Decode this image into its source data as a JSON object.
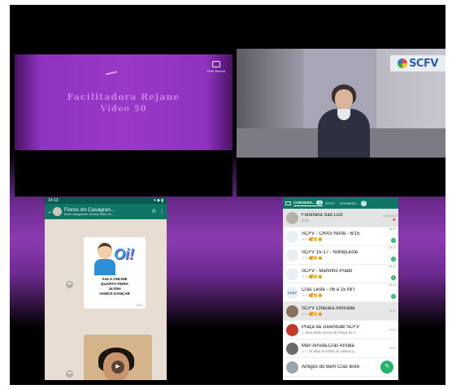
{
  "slide": {
    "title": "Facilitadora Rejane",
    "subtitle": "Vídeo 50",
    "record_label": "Pare Record"
  },
  "camera": {
    "logo_text": "SCFV"
  },
  "phone_chat": {
    "status_time": "14:13",
    "group_name": "Flores do Casagran...",
    "group_members": "Elvira Casagrande, Eneida, Erika, Eri...",
    "message_caption": [
      "AULA ONLINE",
      "QUARTA FEIRA",
      "16:00H",
      "VAMOS DANÇAR"
    ],
    "message_time": "14:07"
  },
  "whatsapp": {
    "tabs": [
      {
        "label": "CONVERS...",
        "count": "10",
        "active": true
      },
      {
        "label": "STAT...",
        "active": false
      },
      {
        "label": "CHAMAD...",
        "active": false
      }
    ],
    "chats": [
      {
        "name": "Funerária São Luiz",
        "preview": "0:14",
        "time": "07/05/2020",
        "pinned": true,
        "avatar": "#b6b0a8"
      },
      {
        "name": "SCFV - CRAS Norte - 6/15",
        "preview": "✓✓ 🥰🙂😄",
        "time": "14:11",
        "badge": "1",
        "avatar": "#e9eef3"
      },
      {
        "name": "SCFV 15-17 - Norte|Leste",
        "preview": "✓✓ 🥰🙂😄",
        "time": "14:11",
        "badge": "1",
        "avatar": "#e9eef3"
      },
      {
        "name": "SCFV - Martinho Prado",
        "preview": "✓✓ 🥰🙂😄",
        "time": "14:11",
        "badge": "1",
        "avatar": "#e9eef3"
      },
      {
        "name": "Cras Leste - 06 a 15 M/T",
        "preview": "✓✓ 🥰🙂😄",
        "time": "14:11",
        "badge": "1",
        "avatar": "#e9eef3",
        "avatar_text": "SCFV"
      },
      {
        "name": "SCFV  Chácara  Alvorada",
        "preview": "✓✓ 🥰🙂😄",
        "time": "14:11",
        "avatar": "#8a6f5c",
        "highlight": true
      },
      {
        "name": "Praça da Juventude SCFV",
        "preview": "✓ Boa tarde turma da Praça de J...",
        "time": "14:10",
        "avatar": "#c0392b"
      },
      {
        "name": "Mari Arruda.Cras Arruda",
        "preview": "✓✓ Oi Mari ai estão os vídeos p...",
        "time": "14:09",
        "avatar": "#6b6b6b"
      },
      {
        "name": "Amigos do Bem Cras leste",
        "preview": "",
        "time": "",
        "avatar": "#9aa5b0"
      }
    ]
  }
}
